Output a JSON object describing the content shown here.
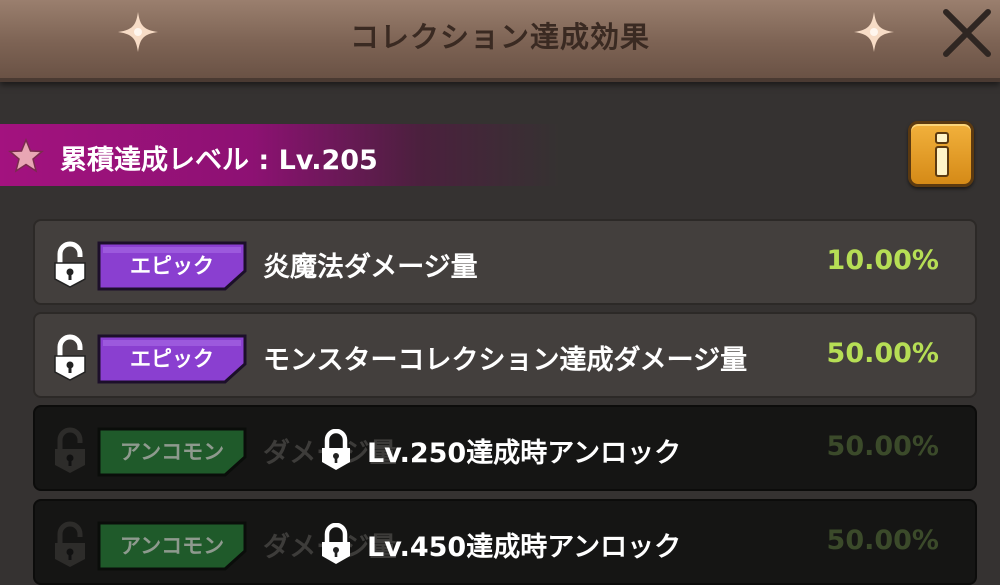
{
  "header": {
    "title": "コレクション達成効果",
    "close_icon": "close-icon"
  },
  "level": {
    "label": "累積達成レベル : Lv.205"
  },
  "colors": {
    "epic_tag": "#8a3fd0",
    "uncommon_tag": "#1f5a2a",
    "value_green": "#b6de55",
    "banner_magenta": "#a3127f",
    "info_button": "#e9a02a"
  },
  "rows": [
    {
      "tag": "エピック",
      "name": "炎魔法ダメージ量",
      "value": "10.00%",
      "locked": false
    },
    {
      "tag": "エピック",
      "name": "モンスターコレクション達成ダメージ量",
      "value": "50.00%",
      "locked": false
    },
    {
      "tag": "アンコモン",
      "name": "ダメージ量",
      "value": "50.00%",
      "locked": true,
      "unlock_text": "Lv.250達成時アンロック"
    },
    {
      "tag": "アンコモン",
      "name": "ダメージ量",
      "value": "50.00%",
      "locked": true,
      "unlock_text": "Lv.450達成時アンロック"
    }
  ]
}
